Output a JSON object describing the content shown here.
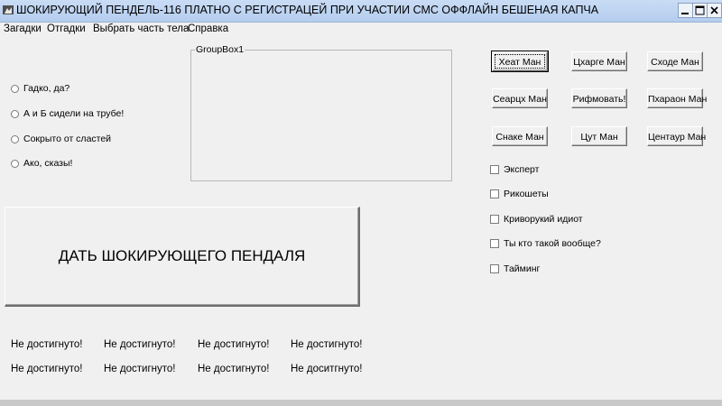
{
  "window": {
    "title": "ШОКИРУЮЩИЙ ПЕНДЕЛЬ-116 ПЛАТНО С РЕГИСТРАЦЕЙ ПРИ УЧАСТИИ СМС ОФФЛАЙН БЕШЕНАЯ КАПЧА",
    "minimize_label": "_",
    "maximize_label": "□",
    "close_label": "X"
  },
  "menu": [
    "Загадки",
    "Отгадки",
    "Выбрать часть тела",
    "Справка"
  ],
  "radios": [
    "Гадко, да?",
    "А и Б сидели на трубе!",
    "Сокрыто от сластей",
    "Ако, сказы!"
  ],
  "groupbox": {
    "title": "GroupBox1"
  },
  "main_button": "ДАТЬ ШОКИРУЮЩЕГО ПЕНДАЛЯ",
  "buttons": [
    "Хеат Ман",
    "Цхарге Ман",
    "Сходе Ман",
    "Сеарцх Ман",
    "Рифмовать!",
    "Пхараон Ман",
    "Снаке Ман",
    "Цут Ман",
    "Центаур Ман"
  ],
  "checkboxes": [
    "Эксперт",
    "Рикошеты",
    "Криворукий идиот",
    "Ты кто такой вообще?",
    "Тайминг"
  ],
  "achievements": [
    "Не достигнуто!",
    "Не достигнуто!",
    "Не достигнуто!",
    "Не достигнуто!",
    "Не достигнуто!",
    "Не достигнуто!",
    "Не достигнуто!",
    "Не доситгнуто!"
  ]
}
